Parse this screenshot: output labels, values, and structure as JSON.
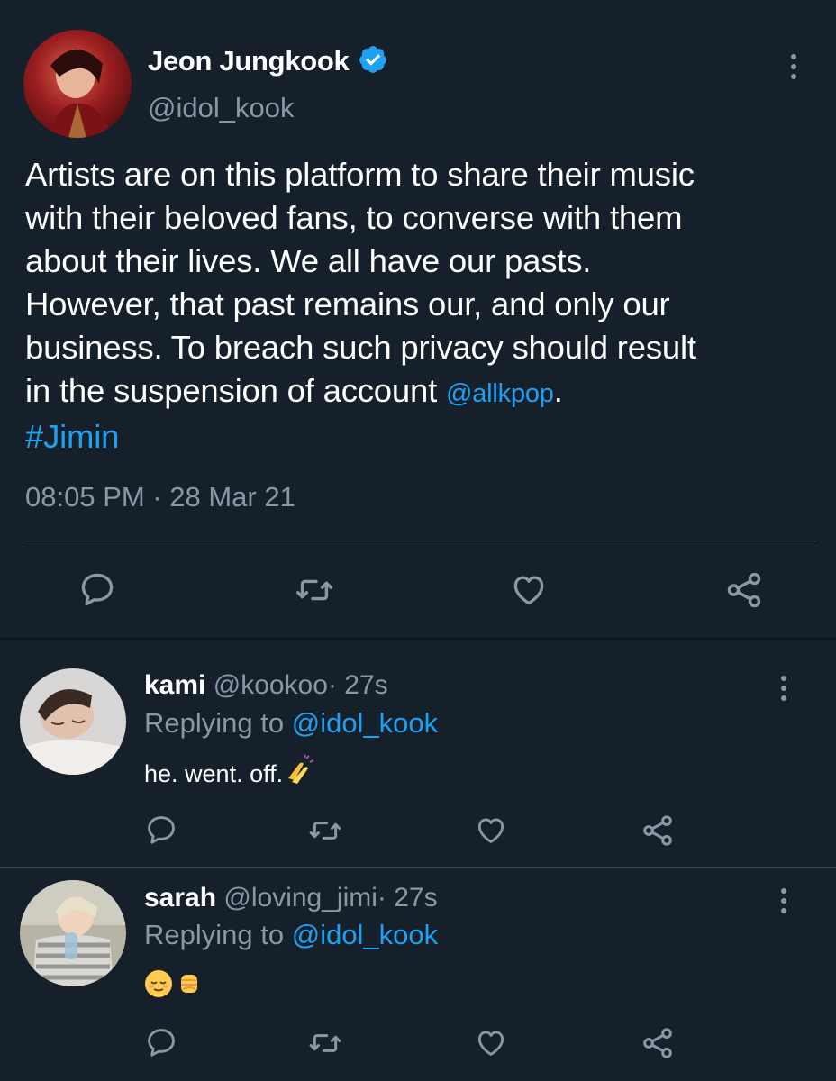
{
  "main_tweet": {
    "display_name": "Jeon Jungkook",
    "handle": "@idol_kook",
    "verified": true,
    "text_lines": [
      "Artists are on this platform to share their music",
      "with their beloved fans, to converse with them",
      "about their lives. We all have our pasts.",
      "However, that past remains our, and only our",
      "business. To breach such privacy should result"
    ],
    "last_line_text": "in the suspension of account ",
    "mention": "@allkpop",
    "period": ".",
    "hashtag": "#Jimin",
    "timestamp": "08:05 PM · 28 Mar 21"
  },
  "replies": [
    {
      "display_name": "kami",
      "handle": "@kookoo",
      "time": "· 27s",
      "replying_label": "Replying to ",
      "replying_to": "@idol_kook",
      "text": "he. went. off."
    },
    {
      "display_name": "sarah",
      "handle": "@loving_jimi",
      "time": "· 27s",
      "replying_label": "Replying to ",
      "replying_to": "@idol_kook",
      "text": ""
    }
  ],
  "icons": [
    "reply-icon",
    "retweet-icon",
    "like-icon",
    "share-icon",
    "more-icon",
    "verified-badge-icon"
  ],
  "colors": {
    "background": "#15202b",
    "link": "#1da1f2",
    "muted": "#8899a6",
    "divider": "#38444d"
  }
}
